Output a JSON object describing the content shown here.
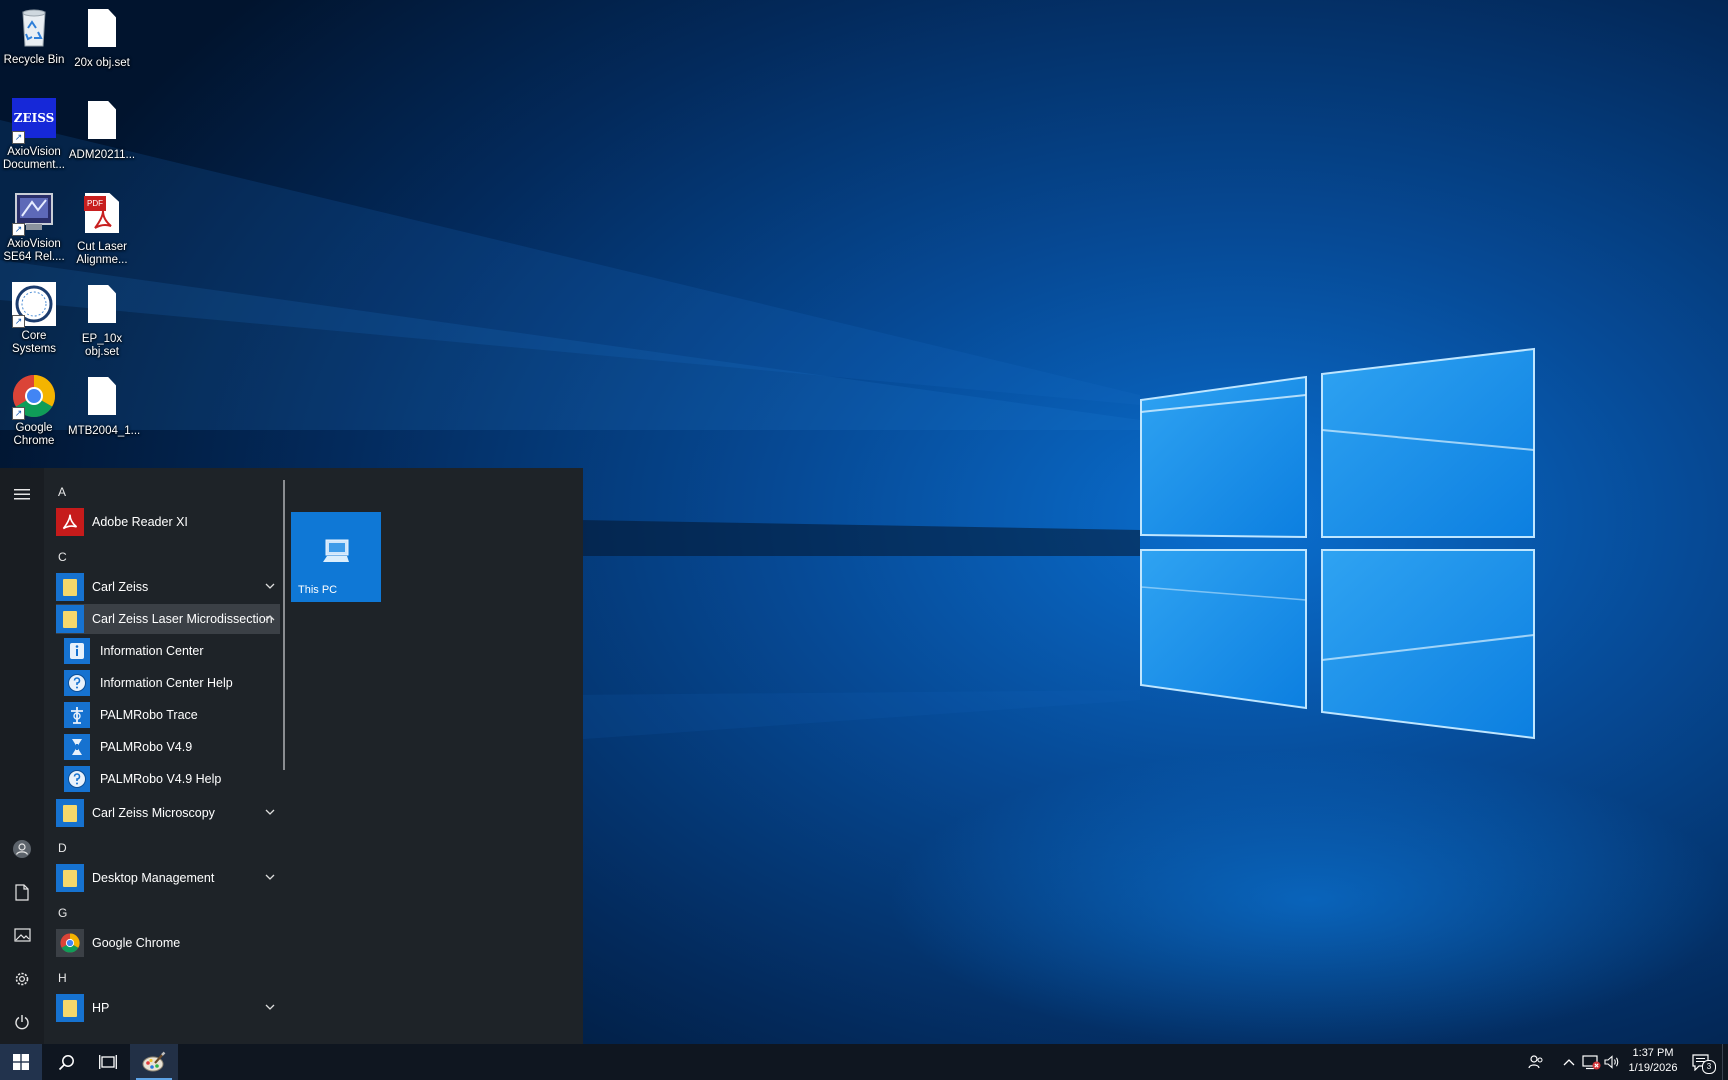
{
  "desktop": {
    "icons": [
      {
        "label": "Recycle Bin",
        "icon": "recycle-bin-icon"
      },
      {
        "label": "20x obj.set",
        "icon": "file-icon"
      },
      {
        "label": "AxioVision Document...",
        "icon": "zeiss-icon",
        "logo_text": "ZEISS"
      },
      {
        "label": "ADM20211...",
        "icon": "file-icon"
      },
      {
        "label": "AxioVision SE64 Rel....",
        "icon": "axiovision-app-icon"
      },
      {
        "label": "Cut Laser Alignme...",
        "icon": "pdf-icon",
        "badge": "PDF"
      },
      {
        "label": "Core Systems",
        "icon": "core-systems-icon"
      },
      {
        "label": "EP_10x obj.set",
        "icon": "file-icon"
      },
      {
        "label": "Google Chrome",
        "icon": "chrome-icon"
      },
      {
        "label": "MTB2004_1...",
        "icon": "file-icon"
      }
    ]
  },
  "start_menu": {
    "rail": [
      "hamburger-icon",
      "user-icon",
      "documents-icon",
      "pictures-icon",
      "settings-icon",
      "power-icon"
    ],
    "letters": {
      "a": "A",
      "c": "C",
      "d": "D",
      "g": "G",
      "h": "H"
    },
    "apps": {
      "adobe_reader": "Adobe Reader XI",
      "carl_zeiss": "Carl Zeiss",
      "carl_zeiss_lmd": "Carl Zeiss Laser Microdissection",
      "information_center": "Information Center",
      "information_center_help": "Information Center Help",
      "palmrobo_trace": "PALMRobo Trace",
      "palmrobo_v49": "PALMRobo V4.9",
      "palmrobo_v49_help": "PALMRobo V4.9 Help",
      "carl_zeiss_microscopy": "Carl Zeiss Microscopy",
      "desktop_management": "Desktop Management",
      "google_chrome": "Google Chrome",
      "hp": "HP"
    },
    "tiles": [
      {
        "label": "This PC",
        "icon": "this-pc-icon"
      }
    ]
  },
  "taskbar": {
    "buttons": [
      "windows-start-icon",
      "search-icon",
      "task-view-icon",
      "paint-icon"
    ],
    "tray": [
      "people-icon",
      "chevron-up-icon",
      "network-disconnected-icon",
      "volume-icon"
    ],
    "clock": {
      "time": "1:37 PM",
      "date": "1/19/2026"
    },
    "notifications": {
      "count": "3",
      "icon": "action-center-icon"
    }
  },
  "colors": {
    "accent": "#0f78d6",
    "start_bg": "#1e2328",
    "taskbar_bg": "#0f1620",
    "folder": "#f6d86b"
  }
}
